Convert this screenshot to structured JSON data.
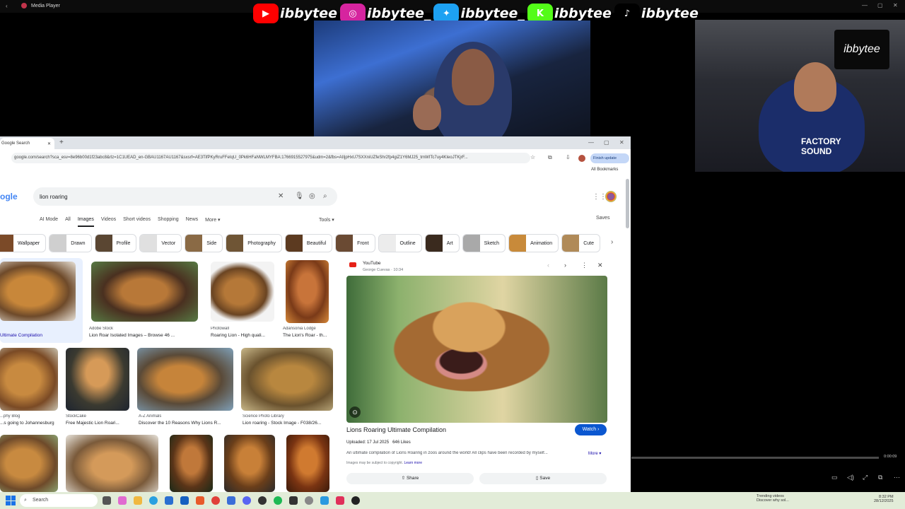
{
  "window": {
    "title": "Media Player",
    "minimize": "—",
    "maximize": "▢",
    "close": "✕"
  },
  "social": [
    {
      "platform": "youtube",
      "icon": "youtube-icon",
      "handle": "ibbytee",
      "color": "#ff0000"
    },
    {
      "platform": "instagram",
      "icon": "instagram-icon",
      "handle": "ibbytee_",
      "color": "#d6249f"
    },
    {
      "platform": "twitter",
      "icon": "twitter-icon",
      "handle": "ibbytee_",
      "color": "#1da1f2"
    },
    {
      "platform": "kick",
      "icon": "kick-icon",
      "handle": "ibbytee",
      "color": "#53fc18"
    },
    {
      "platform": "tiktok",
      "icon": "tiktok-icon",
      "handle": "ibbytee",
      "color": "#000000"
    }
  ],
  "browser": {
    "tab_title": "Google Search",
    "tab_close": "✕",
    "new_tab": "+",
    "url": "google.com/search?sca_esv=8e96b00d1f23abc8&rlz=1C1UEAD_en-GBAU1167AU1167&sxsrf=AE3TifPKyRruFFeIqU_0Pk6HFaNWLMYFBA:1766915527975&udm=2&fbs=AIIjpHxU7SXXniUZfeShr2fp4giZ1Y6MJ25_tmWITc7uy4KIeoJTKjrF...",
    "finish_update": "Finish update",
    "all_bookmarks": "All Bookmarks",
    "logo": "ogle",
    "query": "lion roaring",
    "nav_tabs": [
      "AI Mode",
      "All",
      "Images",
      "Videos",
      "Short videos",
      "Shopping",
      "News",
      "More ▾"
    ],
    "active_tab": "Images",
    "tools": "Tools ▾",
    "saves": "Saves",
    "chips": [
      {
        "label": "Wallpaper",
        "color": "#7b4a28"
      },
      {
        "label": "Drawn",
        "color": "#cfcfcf"
      },
      {
        "label": "Profile",
        "color": "#5a4632"
      },
      {
        "label": "Vector",
        "color": "#e0e0e0"
      },
      {
        "label": "Side",
        "color": "#8a6a45"
      },
      {
        "label": "Photography",
        "color": "#6f5535"
      },
      {
        "label": "Beautiful",
        "color": "#5c3a20"
      },
      {
        "label": "Front",
        "color": "#6a4a33"
      },
      {
        "label": "Outline",
        "color": "#ececec"
      },
      {
        "label": "Art",
        "color": "#3a2a1e"
      },
      {
        "label": "Sketch",
        "color": "#a9a9a9"
      },
      {
        "label": "Animation",
        "color": "#c88a3a"
      },
      {
        "label": "Cute",
        "color": "#b08a58"
      }
    ],
    "results": [
      {
        "source": "",
        "caption": "Ultimate Compilation"
      },
      {
        "source": "Adobe Stock",
        "caption": "Lion Roar Isolated Images – Browse 46 ..."
      },
      {
        "source": "Photowall",
        "caption": "Roaring Lion - High quali..."
      },
      {
        "source": "Adansonia Lodge",
        "caption": "The Lion's Roar - th..."
      },
      {
        "source": "...phy Blog",
        "caption": "...s going to Johannesburg"
      },
      {
        "source": "StockCake",
        "caption": "Free Majestic Lion Roari..."
      },
      {
        "source": "A-Z Animals",
        "caption": "Discover the 10 Reasons Why Lions R..."
      },
      {
        "source": "Science Photo Library",
        "caption": "Lion roaring - Stock Image - F038/26..."
      }
    ],
    "preview": {
      "source": "YouTube",
      "author": "George Cuevas · 10:34",
      "title": "Lions Roaring Ultimate Compilation",
      "watch": "Watch ›",
      "uploaded": "Uploaded: 17 Jul 2025",
      "likes": "646 Likes",
      "description": "An ultimate compilation of Lions Roaring in zoos around the world! All clips have been recorded by myself...",
      "more": "More ▾",
      "copyright": "Images may be subject to copyright.",
      "learn_more": "Learn more",
      "share": "Share",
      "save": "Save"
    }
  },
  "player": {
    "time": "0:00:09",
    "progress_fraction": 0.0
  },
  "taskbar": {
    "search": "Search",
    "tray_title": "Trending videos",
    "tray_sub": "Discover why sol...",
    "time": "8:32 PM",
    "date": "28/12/2025"
  }
}
